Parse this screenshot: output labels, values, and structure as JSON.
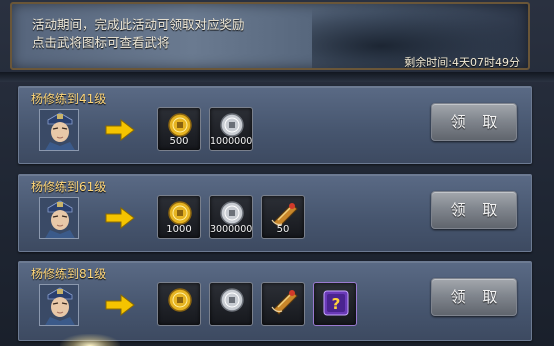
{
  "banner": {
    "line1": "活动期间，完成此活动可领取对应奖励",
    "line2": "点击武将图标可查看武将",
    "timer": "剩余时间:4天07时49分"
  },
  "rows": [
    {
      "title": "杨修练到41级",
      "claim_label": "领 取",
      "rewards": [
        {
          "icon": "gold-coin-icon",
          "qty": "500"
        },
        {
          "icon": "silver-coin-icon",
          "qty": "1000000"
        }
      ]
    },
    {
      "title": "杨修练到61级",
      "claim_label": "领 取",
      "rewards": [
        {
          "icon": "gold-coin-icon",
          "qty": "1000"
        },
        {
          "icon": "silver-coin-icon",
          "qty": "3000000"
        },
        {
          "icon": "scroll-item-icon",
          "qty": "50"
        }
      ]
    },
    {
      "title": "杨修练到81级",
      "claim_label": "领 取",
      "rewards": [
        {
          "icon": "gold-coin-icon",
          "qty": ""
        },
        {
          "icon": "silver-coin-icon",
          "qty": ""
        },
        {
          "icon": "scroll-item-icon",
          "qty": ""
        },
        {
          "icon": "mystery-box-icon",
          "qty": ""
        }
      ]
    }
  ],
  "colors": {
    "title_gold": "#ffd77a",
    "row_bg": "#4d5c76",
    "claim_button": "#8a8f97",
    "arrow": "#f5c400"
  }
}
